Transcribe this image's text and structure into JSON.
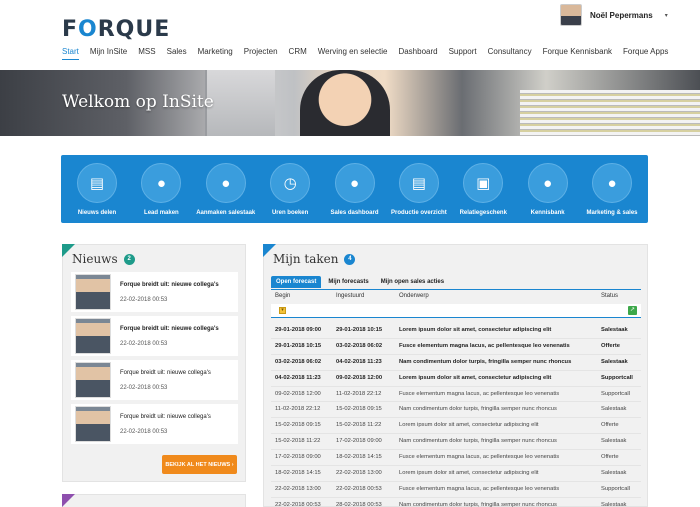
{
  "header": {
    "logo_prefix": "F",
    "logo_o": "O",
    "logo_suffix": "RQUE",
    "user_name": "Noël Pepermans",
    "user_caret": "▾"
  },
  "nav": [
    "Start",
    "Mijn InSite",
    "MSS",
    "Sales",
    "Marketing",
    "Projecten",
    "CRM",
    "Werving en selectie",
    "Dashboard",
    "Support",
    "Consultancy",
    "Forque Kennisbank",
    "Forque Apps"
  ],
  "hero": {
    "title": "Welkom op InSite"
  },
  "quick_links": [
    {
      "label": "Nieuws delen",
      "icon": "newspaper-icon",
      "glyph": "▤"
    },
    {
      "label": "Lead maken",
      "icon": "user-add-icon",
      "glyph": "●"
    },
    {
      "label": "Aanmaken salestaak",
      "icon": "user-task-icon",
      "glyph": "●"
    },
    {
      "label": "Uren boeken",
      "icon": "stopwatch-icon",
      "glyph": "◷"
    },
    {
      "label": "Sales dashboard",
      "icon": "user-glasses-icon",
      "glyph": "●"
    },
    {
      "label": "Productie overzicht",
      "icon": "document-icon",
      "glyph": "▤"
    },
    {
      "label": "Relatiegeschenk",
      "icon": "gift-icon",
      "glyph": "▣"
    },
    {
      "label": "Kennisbank",
      "icon": "user-question-icon",
      "glyph": "●"
    },
    {
      "label": "Marketing & sales",
      "icon": "user-chart-icon",
      "glyph": "●"
    }
  ],
  "news": {
    "title": "Nieuws",
    "count": "2",
    "items": [
      {
        "title": "Forque breidt uit: nieuwe collega's",
        "date": "22-02-2018 00:53",
        "bold": true
      },
      {
        "title": "Forque breidt uit: nieuwe collega's",
        "date": "22-02-2018 00:53",
        "bold": true
      },
      {
        "title": "Forque breidt uit: nieuwe collega's",
        "date": "22-02-2018 00:53",
        "bold": false
      },
      {
        "title": "Forque breidt uit: nieuwe collega's",
        "date": "22-02-2018 00:53",
        "bold": false
      }
    ],
    "all_button": "BEKIJK AL HET NIEUWS ›"
  },
  "tasks": {
    "title": "Mijn taken",
    "count": "4",
    "tabs": [
      "Open forecast",
      "Mijn forecasts",
      "Mijn open sales acties"
    ],
    "columns": {
      "begin": "Begin",
      "due": "Ingestuurd",
      "subject": "Onderwerp",
      "status": "Status"
    },
    "filter_glyph": "▾",
    "export_glyph": "↗",
    "rows": [
      {
        "begin": "29-01-2018 09:00",
        "due": "29-01-2018 10:15",
        "subject": "Lorem ipsum dolor sit amet, consectetur adipiscing elit",
        "status": "Salestaak",
        "bold": true
      },
      {
        "begin": "29-01-2018 10:15",
        "due": "03-02-2018 06:02",
        "subject": "Fusce elementum magna lacus, ac pellentesque leo venenatis",
        "status": "Offerte",
        "bold": true
      },
      {
        "begin": "03-02-2018 06:02",
        "due": "04-02-2018 11:23",
        "subject": "Nam condimentum dolor turpis, fringilla semper nunc rhoncus",
        "status": "Salestaak",
        "bold": true
      },
      {
        "begin": "04-02-2018 11:23",
        "due": "09-02-2018 12:00",
        "subject": "Lorem ipsum dolor sit amet, consectetur adipiscing elit",
        "status": "Supportcall",
        "bold": true
      },
      {
        "begin": "09-02-2018 12:00",
        "due": "11-02-2018 22:12",
        "subject": "Fusce elementum magna lacus, ac pellentesque leo venenatis",
        "status": "Supportcall",
        "bold": false
      },
      {
        "begin": "11-02-2018 22:12",
        "due": "15-02-2018 09:15",
        "subject": "Nam condimentum dolor turpis, fringilla semper nunc rhoncus",
        "status": "Salestaak",
        "bold": false
      },
      {
        "begin": "15-02-2018 09:15",
        "due": "15-02-2018 11:22",
        "subject": "Lorem ipsum dolor sit amet, consectetur adipiscing elit",
        "status": "Offerte",
        "bold": false
      },
      {
        "begin": "15-02-2018 11:22",
        "due": "17-02-2018 09:00",
        "subject": "Nam condimentum dolor turpis, fringilla semper nunc rhoncus",
        "status": "Salestaak",
        "bold": false
      },
      {
        "begin": "17-02-2018 09:00",
        "due": "18-02-2018 14:15",
        "subject": "Fusce elementum magna lacus, ac pellentesque leo venenatis",
        "status": "Offerte",
        "bold": false
      },
      {
        "begin": "18-02-2018 14:15",
        "due": "22-02-2018 13:00",
        "subject": "Lorem ipsum dolor sit amet, consectetur adipiscing elit",
        "status": "Salestaak",
        "bold": false
      },
      {
        "begin": "22-02-2018 13:00",
        "due": "22-02-2018 00:53",
        "subject": "Fusce elementum magna lacus, ac pellentesque leo venenatis",
        "status": "Supportcall",
        "bold": false
      },
      {
        "begin": "22-02-2018 00:53",
        "due": "28-02-2018 00:53",
        "subject": "Nam condimentum dolor turpis, fringilla semper nunc rhoncus",
        "status": "Salestaak",
        "bold": false
      }
    ]
  }
}
